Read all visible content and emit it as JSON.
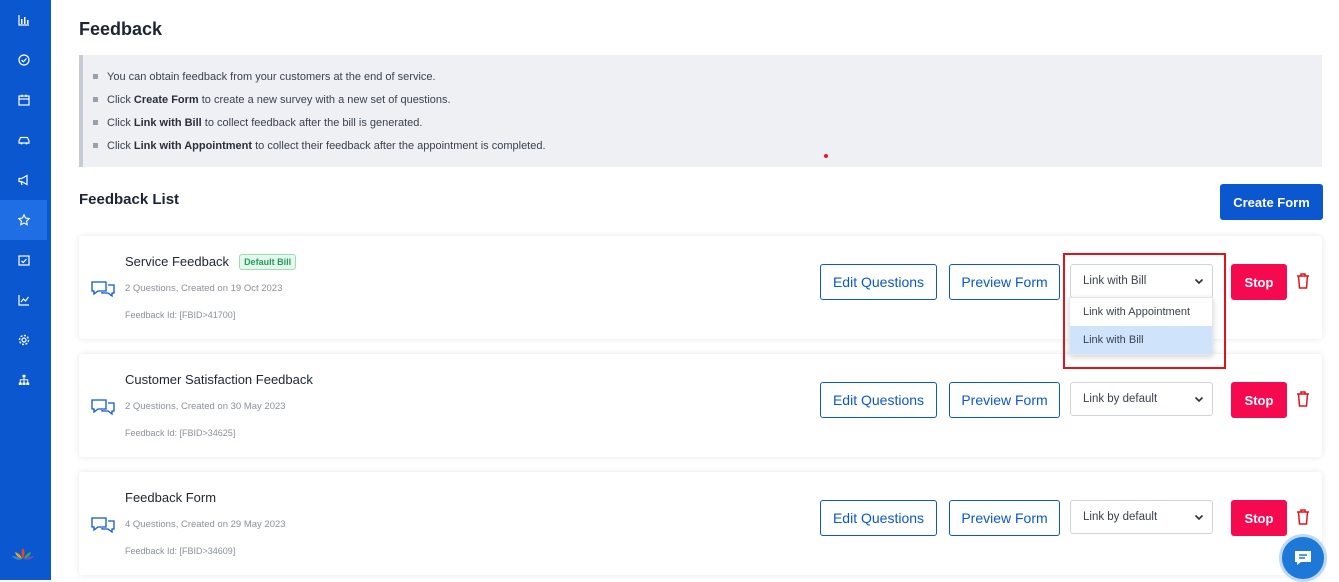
{
  "page": {
    "title": "Feedback"
  },
  "info": {
    "lines": [
      {
        "pre": "You can obtain feedback from your customers at the end of service.",
        "bold": "",
        "post": ""
      },
      {
        "pre": "Click ",
        "bold": "Create Form",
        "post": " to create a new survey with a new set of questions."
      },
      {
        "pre": "Click ",
        "bold": "Link with Bill",
        "post": " to collect feedback after the bill is generated."
      },
      {
        "pre": "Click ",
        "bold": "Link with Appointment",
        "post": " to collect their feedback after the appointment is completed."
      }
    ]
  },
  "list": {
    "title": "Feedback List",
    "create_label": "Create Form"
  },
  "buttons": {
    "edit": "Edit Questions",
    "preview": "Preview Form",
    "stop": "Stop"
  },
  "cards": [
    {
      "name": "Service Feedback",
      "badge": "Default Bill",
      "meta": "2 Questions, Created on 19 Oct 2023",
      "id": "Feedback Id: [FBID>41700]",
      "link": "Link with Bill"
    },
    {
      "name": "Customer Satisfaction Feedback",
      "badge": "",
      "meta": "2 Questions, Created on 30 May 2023",
      "id": "Feedback Id: [FBID>34625]",
      "link": "Link by default"
    },
    {
      "name": "Feedback Form",
      "badge": "",
      "meta": "4 Questions, Created on 29 May 2023",
      "id": "Feedback Id: [FBID>34609]",
      "link": "Link by default"
    }
  ],
  "dropdown": {
    "options": [
      "Link with Appointment",
      "Link with Bill"
    ],
    "selected": "Link with Bill"
  },
  "sidebar": {
    "icons": [
      "bar-chart-icon",
      "check-circle-icon",
      "calendar-icon",
      "car-icon",
      "megaphone-icon",
      "star-icon",
      "calendar-check-icon",
      "line-chart-icon",
      "gear-icon",
      "org-chart-icon"
    ],
    "active": "star-icon"
  },
  "colors": {
    "primary": "#0a57cf",
    "stop": "#f50a4f",
    "badge": "#22a05a",
    "highlight": "#e0141c"
  }
}
